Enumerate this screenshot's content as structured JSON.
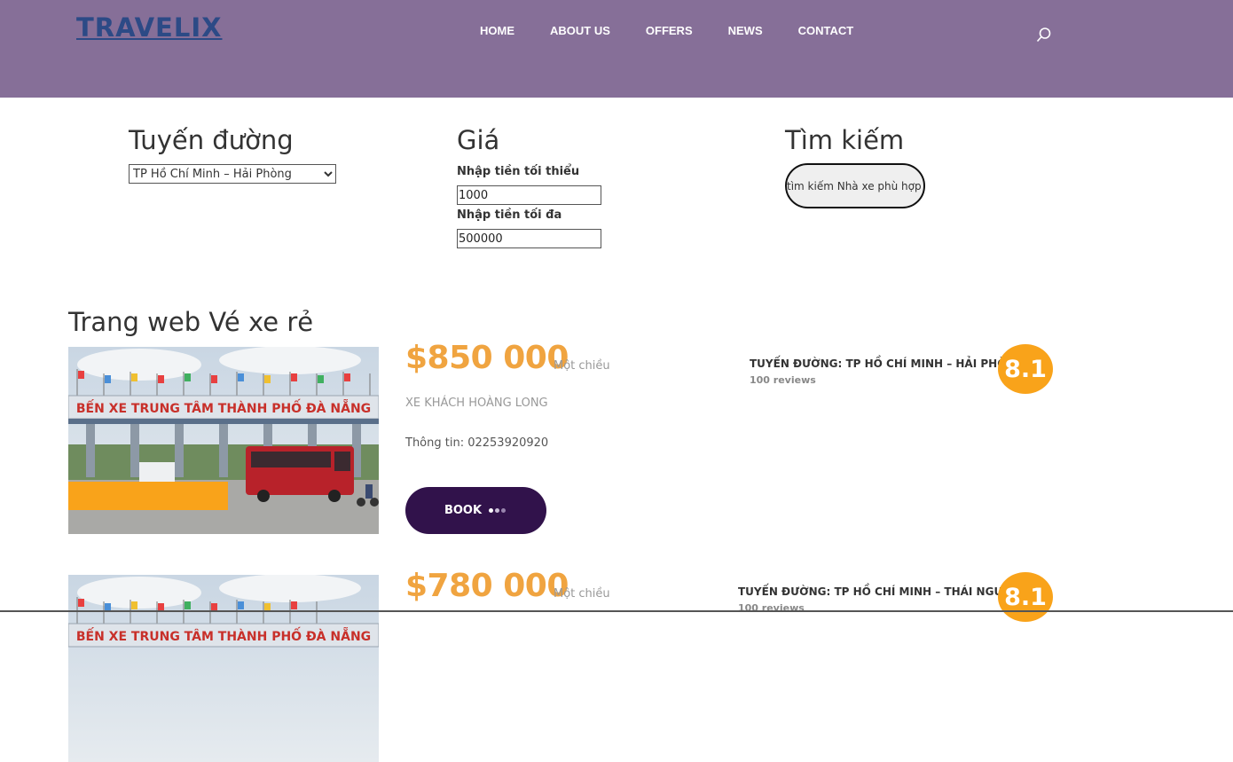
{
  "header": {
    "logo": "TRAVELIX",
    "nav": [
      "HOME",
      "ABOUT US",
      "OFFERS",
      "NEWS",
      "CONTACT"
    ]
  },
  "filters": {
    "route_title": "Tuyến đường",
    "route_selected": "TP Hồ Chí Minh – Hải Phòng",
    "price_title": "Giá",
    "min_label": "Nhập tiền tối thiểu",
    "min_value": "1000",
    "max_label": "Nhập tiền tối đa",
    "max_value": "500000",
    "search_title": "Tìm kiếm",
    "search_button": "tìm kiếm Nhà xe phù hợp"
  },
  "section_title": "Trang web Vé xe rẻ",
  "results": [
    {
      "price": "$850 000",
      "trip": "Một chiều",
      "company": "Xe khách Hoàng Long",
      "info": "Thông tin: 02253920920",
      "book": "BOOK",
      "route": "Tuyến đường: TP Hồ Chí Minh – Hải Phòng",
      "reviews": "100 reviews",
      "score": "8.1",
      "photo_sign": "BẾN XE TRUNG TÂM THÀNH PHỐ ĐÀ NẴNG"
    },
    {
      "price": "$780 000",
      "trip": "Một chiều",
      "route": "Tuyến đường: TP Hồ Chí Minh – Thái Nguyên",
      "reviews": "100 reviews",
      "score": "8.1",
      "photo_sign": "BẾN XE TRUNG TÂM THÀNH PHỐ ĐÀ NẴNG"
    }
  ],
  "colors": {
    "header_bg": "#866f98",
    "accent": "#f0a440",
    "book_bg": "#31124b",
    "score_bg": "#f9a31a"
  }
}
